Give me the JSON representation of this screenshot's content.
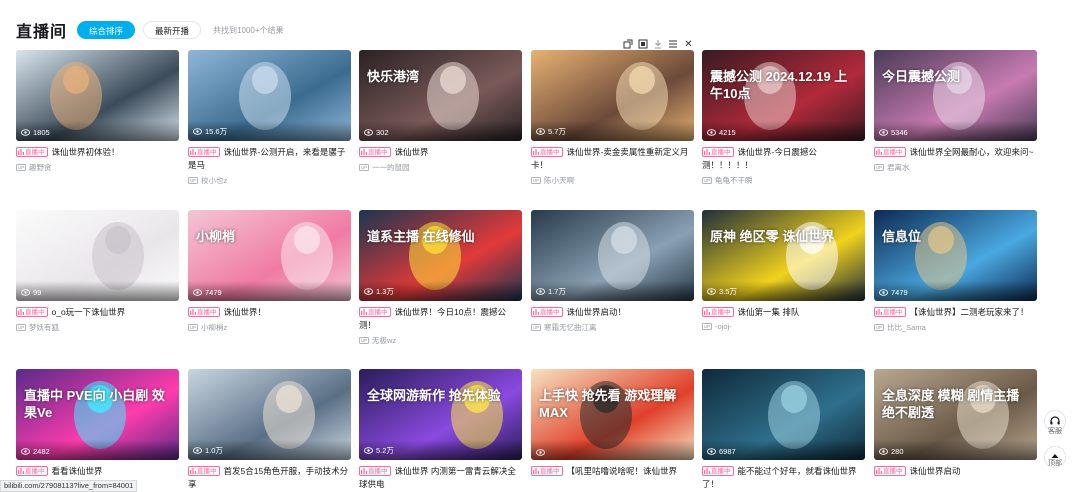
{
  "header": {
    "title": "直播间",
    "sort_options": [
      {
        "label": "综合排序",
        "active": true
      },
      {
        "label": "最新开播",
        "active": false
      }
    ],
    "result_count": "共找到1000+个结果"
  },
  "floating_toolbar": {
    "icons": [
      "popout-icon",
      "fullscreen-icon",
      "download-icon",
      "menu-icon",
      "close-icon"
    ],
    "close_glyph": "✕"
  },
  "live_badge": "直播中",
  "cards": [
    {
      "viewers": "1805",
      "title": "诛仙世界初体验！",
      "uploader": "趣野贪",
      "overlay_text": "",
      "colors": [
        "#d9e6ee",
        "#3c4b5a",
        "#e8b07a"
      ]
    },
    {
      "viewers": "15.6万",
      "title": "诛仙世界-公测开启，来看是骡子是马",
      "uploader": "校小也z",
      "overlay_text": "",
      "colors": [
        "#8fb6d8",
        "#3b6c8f",
        "#c9dcec"
      ]
    },
    {
      "viewers": "302",
      "title": "诛仙世界",
      "uploader": "一一的鼠园",
      "overlay_text": "快乐港湾",
      "colors": [
        "#2a2224",
        "#7a5a58",
        "#e9d8d3"
      ]
    },
    {
      "viewers": "5.7万",
      "title": "诛仙世界-卖金卖属性重新定义月卡！",
      "uploader": "陈小天啊",
      "overlay_text": "",
      "colors": [
        "#e7b273",
        "#6c4a3a",
        "#f3d9b0"
      ]
    },
    {
      "viewers": "4215",
      "title": "诛仙世界-今日震撼公测！！！！！",
      "uploader": "龟龟不干瞬",
      "overlay_text": "震撼公测 2024.12.19 上午10点",
      "colors": [
        "#3a1a22",
        "#b22a3a",
        "#e8c9c9"
      ]
    },
    {
      "viewers": "5346",
      "title": "诛仙世界全网最耐心，欢迎来问~",
      "uploader": "君离水",
      "overlay_text": "今日震撼公测",
      "colors": [
        "#4a3b57",
        "#c77bb0",
        "#e8d5e8"
      ]
    },
    {
      "viewers": "99",
      "title": "o_o玩一下诛仙世界",
      "uploader": "梦妖有狐",
      "overlay_text": "",
      "colors": [
        "#fbfbfb",
        "#e9e6ea",
        "#c9c3cb"
      ]
    },
    {
      "viewers": "7479",
      "title": "诛仙世界！",
      "uploader": "小柳梢z",
      "overlay_text": "小柳梢",
      "colors": [
        "#f3c6d4",
        "#f07aa3",
        "#fbe6ed"
      ]
    },
    {
      "viewers": "1.3万",
      "title": "诛仙世界！今日10点！震撼公测！",
      "uploader": "无极wz",
      "overlay_text": "道系主播 在线修仙",
      "colors": [
        "#1c3550",
        "#e23a3a",
        "#ffe13a"
      ]
    },
    {
      "viewers": "1.7万",
      "title": "诛仙世界启动！",
      "uploader": "寒霜无忆曲江离",
      "overlay_text": "",
      "colors": [
        "#263a4a",
        "#8aa1b3",
        "#d4dde4"
      ]
    },
    {
      "viewers": "3.5万",
      "title": "诛仙第一集 排队",
      "uploader": "-ojoj-",
      "overlay_text": "原神 绝区零 诛仙世界",
      "colors": [
        "#1f2e3a",
        "#f2d21c",
        "#ffffff"
      ]
    },
    {
      "viewers": "7479",
      "title": "【诛仙世界】二测老玩家来了！",
      "uploader": "比比_Sama",
      "overlay_text": "信息位",
      "colors": [
        "#0d2a52",
        "#4aa8e0",
        "#e0c48a"
      ]
    },
    {
      "viewers": "2482",
      "title": "看看诛仙世界",
      "uploader": "",
      "overlay_text": "直播中 PVE向 小白剧 效果Ve",
      "colors": [
        "#5a2a8a",
        "#ff3cac",
        "#3cf0ff"
      ]
    },
    {
      "viewers": "1.0万",
      "title": "首发5合15角色开服，手动技术分享",
      "uploader": "",
      "overlay_text": "",
      "colors": [
        "#c9d6e0",
        "#5a6f86",
        "#ebe2d6"
      ]
    },
    {
      "viewers": "5.2万",
      "title": "诛仙世界 内测第一雷青云解决全球供电",
      "uploader": "",
      "overlay_text": "全球网游新作 抢先体验",
      "colors": [
        "#2a1d5a",
        "#8a4ae0",
        "#ffe84a"
      ]
    },
    {
      "viewers": "",
      "title": "【吼里咕噜说啥呢！诛仙世界",
      "uploader": "",
      "overlay_text": "上手快 抢先看 游戏理解MAX",
      "colors": [
        "#f6e2c0",
        "#e0402a",
        "#2a2a2a"
      ]
    },
    {
      "viewers": "6987",
      "title": "能不能过个好年，就看诛仙世界了！",
      "uploader": "",
      "overlay_text": "",
      "colors": [
        "#0f2a3a",
        "#2f6f8c",
        "#9ad0e0"
      ]
    },
    {
      "viewers": "280",
      "title": "诛仙世界启动",
      "uploader": "",
      "overlay_text": "全息深度 模糊 剧情主播 绝不剧透",
      "colors": [
        "#b8a890",
        "#6a5a48",
        "#e8dcc8"
      ]
    }
  ],
  "sidebar": {
    "customer_service_label": "客服",
    "top_label": "顶部"
  },
  "status_bar": {
    "url": "bilibili.com/27908113?live_from=84001"
  }
}
